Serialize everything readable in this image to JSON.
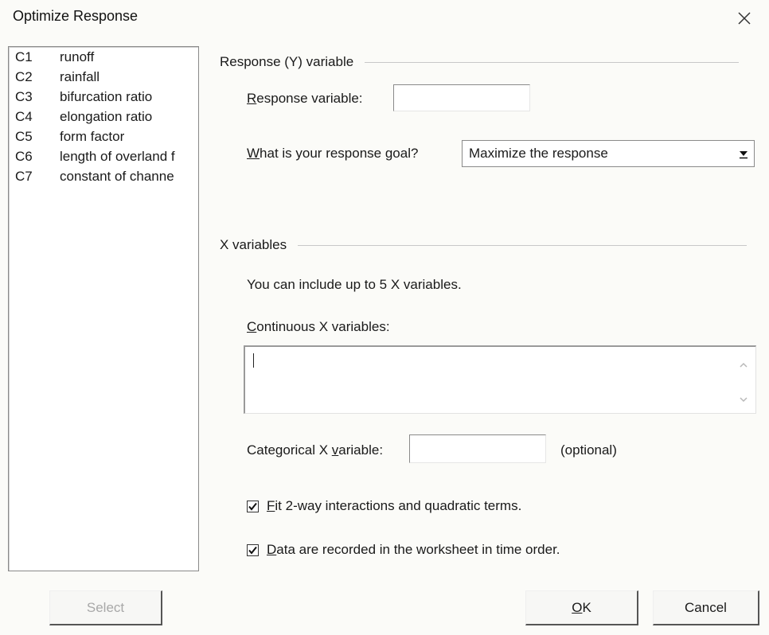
{
  "window": {
    "title": "Optimize Response",
    "close_icon": "close-icon"
  },
  "columns": [
    {
      "id": "C1",
      "name": "runoff"
    },
    {
      "id": "C2",
      "name": "rainfall"
    },
    {
      "id": "C3",
      "name": "bifurcation ratio"
    },
    {
      "id": "C4",
      "name": "elongation ratio"
    },
    {
      "id": "C5",
      "name": "form factor"
    },
    {
      "id": "C6",
      "name": "length of overland f"
    },
    {
      "id": "C7",
      "name": "constant of channe"
    }
  ],
  "response": {
    "section_title": "Response (Y) variable",
    "variable_label_accel": "R",
    "variable_label_rest": "esponse variable:",
    "variable_value": "",
    "goal_label_accel": "W",
    "goal_label_rest": "hat is your response goal?",
    "goal_value": "Maximize the response"
  },
  "xvars": {
    "section_title": "X variables",
    "info": "You can include up to 5 X variables.",
    "continuous_label_accel": "C",
    "continuous_label_rest": "ontinuous X variables:",
    "continuous_value": "",
    "categorical_label_prefix": "Categorical X ",
    "categorical_label_accel": "v",
    "categorical_label_rest": "ariable:",
    "categorical_value": "",
    "optional_text": "(optional)"
  },
  "options": {
    "fit_accel": "F",
    "fit_rest": "it 2-way interactions and quadratic terms.",
    "fit_checked": true,
    "time_accel": "D",
    "time_rest": "ata are recorded in the worksheet in time order.",
    "time_checked": true
  },
  "buttons": {
    "select": "Select",
    "ok_accel": "O",
    "ok_rest": "K",
    "cancel": "Cancel"
  }
}
